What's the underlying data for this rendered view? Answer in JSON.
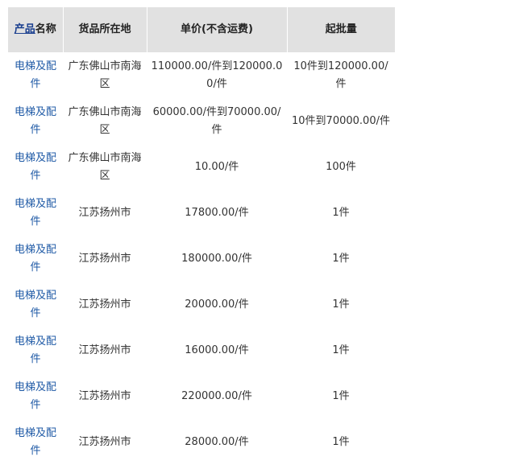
{
  "headers": {
    "name_link": "产品",
    "name_rest": "名称",
    "location": "货品所在地",
    "price": "单价(不含运费)",
    "moq": "起批量"
  },
  "rows": [
    {
      "name": "电梯及配件",
      "location": "广东佛山市南海区",
      "price": "110000.00/件到120000.00/件",
      "moq": "10件到120000.00/件"
    },
    {
      "name": "电梯及配件",
      "location": "广东佛山市南海区",
      "price": "60000.00/件到70000.00/件",
      "moq": "10件到70000.00/件"
    },
    {
      "name": "电梯及配件",
      "location": "广东佛山市南海区",
      "price": "10.00/件",
      "moq": "100件"
    },
    {
      "name": "电梯及配件",
      "location": "江苏扬州市",
      "price": "17800.00/件",
      "moq": "1件"
    },
    {
      "name": "电梯及配件",
      "location": "江苏扬州市",
      "price": "180000.00/件",
      "moq": "1件"
    },
    {
      "name": "电梯及配件",
      "location": "江苏扬州市",
      "price": "20000.00/件",
      "moq": "1件"
    },
    {
      "name": "电梯及配件",
      "location": "江苏扬州市",
      "price": "16000.00/件",
      "moq": "1件"
    },
    {
      "name": "电梯及配件",
      "location": "江苏扬州市",
      "price": "220000.00/件",
      "moq": "1件"
    },
    {
      "name": "电梯及配件",
      "location": "江苏扬州市",
      "price": "28000.00/件",
      "moq": "1件"
    }
  ],
  "colors": {
    "header_bg": "#e1e1e1",
    "link": "#1f5aa6",
    "text": "#333333"
  }
}
